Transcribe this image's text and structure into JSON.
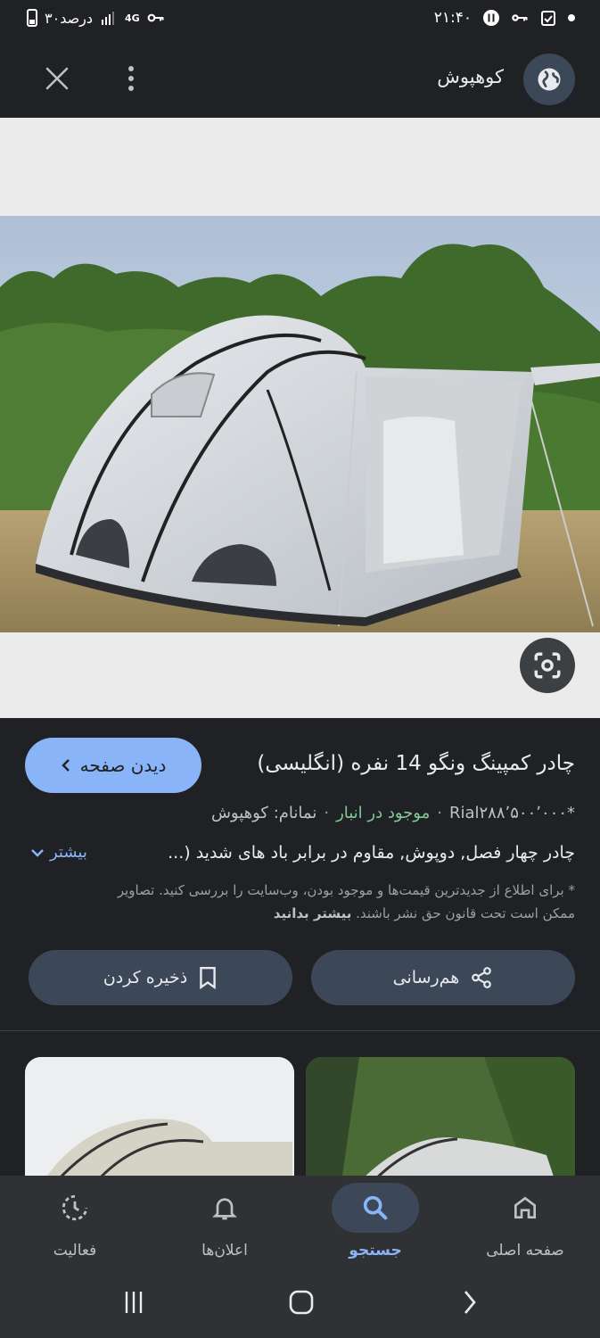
{
  "status_bar": {
    "time": "۲۱:۴۰",
    "battery_text": "۳۰درصد",
    "network": "4G"
  },
  "header": {
    "site_name": "کوهپوش",
    "site_icon": "globe-icon",
    "menu_icon": "more-vert-icon",
    "close_icon": "close-icon"
  },
  "lens_icon": "lens-search-icon",
  "product": {
    "visit_label": "دیدن صفحه",
    "title": "چادر کمپینگ ونگو 14 نفره (انگلیسی)",
    "price": "Rial۲۸۸٬۵۰۰٬۰۰۰*",
    "stock": "موجود در انبار",
    "brand": "نمانام: کوهپوش",
    "description": "چادر چهار فصل, دوپوش, مقاوم در برابر باد های شدید (...",
    "more_label": "بیشتر",
    "disclaimer": "* برای اطلاع از جدیدترین قیمت‌ها و موجود بودن، وب‌سایت را بررسی کنید. تصاویر ممکن است تحت قانون حق نشر باشند.",
    "disclaimer_link": "بیشتر بدانید"
  },
  "actions": {
    "share_label": "هم‌رسانی",
    "save_label": "ذخیره کردن"
  },
  "bottom_nav": {
    "items": [
      {
        "label": "صفحه اصلی",
        "icon": "home-icon"
      },
      {
        "label": "جستجو",
        "icon": "search-icon",
        "active": true
      },
      {
        "label": "اعلان‌ها",
        "icon": "bell-icon"
      },
      {
        "label": "فعالیت",
        "icon": "activity-icon"
      }
    ]
  },
  "colors": {
    "background": "#202124",
    "accent": "#8ab4f8",
    "in_stock": "#81c995",
    "button_bg": "#3c4758"
  }
}
